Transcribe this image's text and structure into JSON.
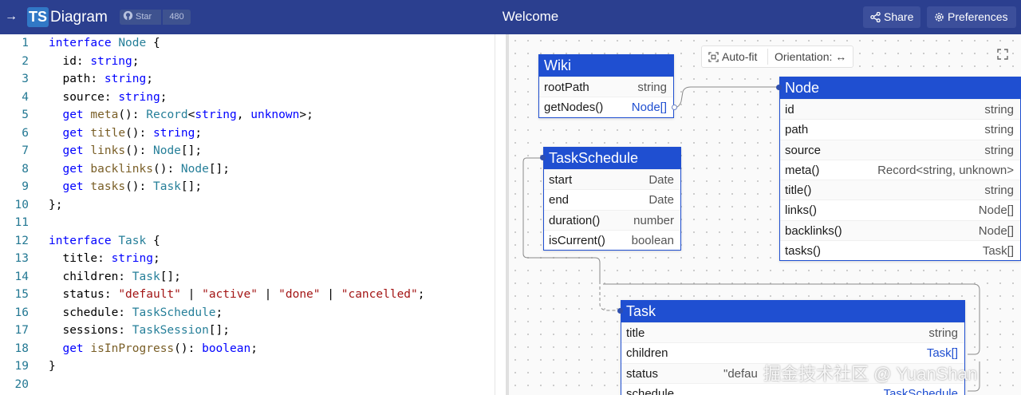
{
  "header": {
    "logo_badge": "TS",
    "logo_text": "Diagram",
    "github_label": "Star",
    "github_count": "480",
    "page_title": "Welcome",
    "share_label": "Share",
    "preferences_label": "Preferences"
  },
  "editor": {
    "line_numbers": [
      "1",
      "2",
      "3",
      "4",
      "5",
      "6",
      "7",
      "8",
      "9",
      "10",
      "11",
      "12",
      "13",
      "14",
      "15",
      "16",
      "17",
      "18",
      "19",
      "20"
    ]
  },
  "canvas": {
    "toolbar": {
      "autofit_label": "Auto-fit",
      "orientation_label": "Orientation: ↔"
    },
    "nodes": {
      "wiki": {
        "title": "Wiki",
        "rows": [
          {
            "name": "rootPath",
            "type": "string"
          },
          {
            "name": "getNodes()",
            "type": "Node[]"
          }
        ]
      },
      "task_schedule": {
        "title": "TaskSchedule",
        "rows": [
          {
            "name": "start",
            "type": "Date"
          },
          {
            "name": "end",
            "type": "Date"
          },
          {
            "name": "duration()",
            "type": "number"
          },
          {
            "name": "isCurrent()",
            "type": "boolean"
          }
        ]
      },
      "node": {
        "title": "Node",
        "rows": [
          {
            "name": "id",
            "type": "string"
          },
          {
            "name": "path",
            "type": "string"
          },
          {
            "name": "source",
            "type": "string"
          },
          {
            "name": "meta()",
            "type": "Record<string, unknown>"
          },
          {
            "name": "title()",
            "type": "string"
          },
          {
            "name": "links()",
            "type": "Node[]"
          },
          {
            "name": "backlinks()",
            "type": "Node[]"
          },
          {
            "name": "tasks()",
            "type": "Task[]"
          }
        ]
      },
      "task": {
        "title": "Task",
        "rows": [
          {
            "name": "title",
            "type": "string"
          },
          {
            "name": "children",
            "type": "Task[]"
          },
          {
            "name": "status",
            "type": "\"defau"
          },
          {
            "name": "schedule",
            "type": "TaskSchedule"
          }
        ]
      }
    }
  },
  "watermark": "掘金技术社区 @ YuanShan",
  "colors": {
    "header_bg": "#2b3f8f",
    "node_accent": "#1f4fd1",
    "keyword": "#0000ff",
    "type": "#267f99",
    "string_literal": "#a31515",
    "line_number": "#237893"
  }
}
